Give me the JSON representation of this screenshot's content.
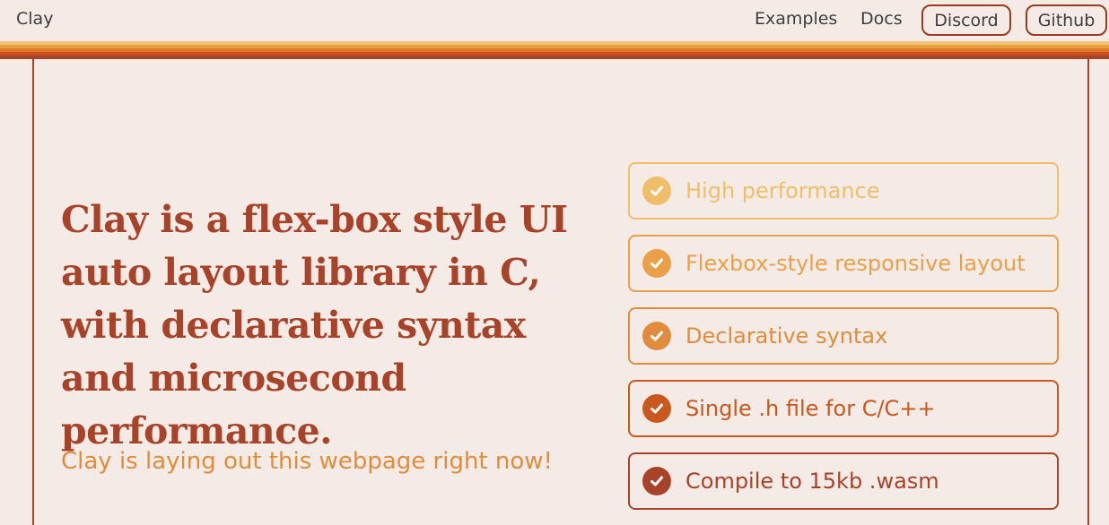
{
  "nav": {
    "logo": "Clay",
    "links": [
      "Examples",
      "Docs"
    ],
    "buttons": [
      "Discord",
      "Github"
    ]
  },
  "stripe_colors": [
    "#f0c27a",
    "#e8a040",
    "#e07828",
    "#c8501c",
    "#a8432a"
  ],
  "hero": {
    "headline": "Clay is a flex-box style UI auto layout library in C, with declarative syntax and microsecond performance.",
    "subline": "Clay is laying out this webpage right now!"
  },
  "features": [
    {
      "label": "High performance",
      "color": "#f0bd68",
      "check_color": "#f0bd68"
    },
    {
      "label": "Flexbox-style responsive layout",
      "color": "#eaa048",
      "check_color": "#eaa048"
    },
    {
      "label": "Declarative syntax",
      "color": "#e08c3c",
      "check_color": "#e08c3c"
    },
    {
      "label": "Single .h file for C/C++",
      "color": "#c8581e",
      "check_color": "#c8581e"
    },
    {
      "label": "Compile to 15kb .wasm",
      "color": "#a8432a",
      "check_color": "#a8432a"
    }
  ],
  "colors": {
    "background": "#f4ebe6",
    "accent": "#a8432a",
    "subline": "#e08c3c"
  }
}
